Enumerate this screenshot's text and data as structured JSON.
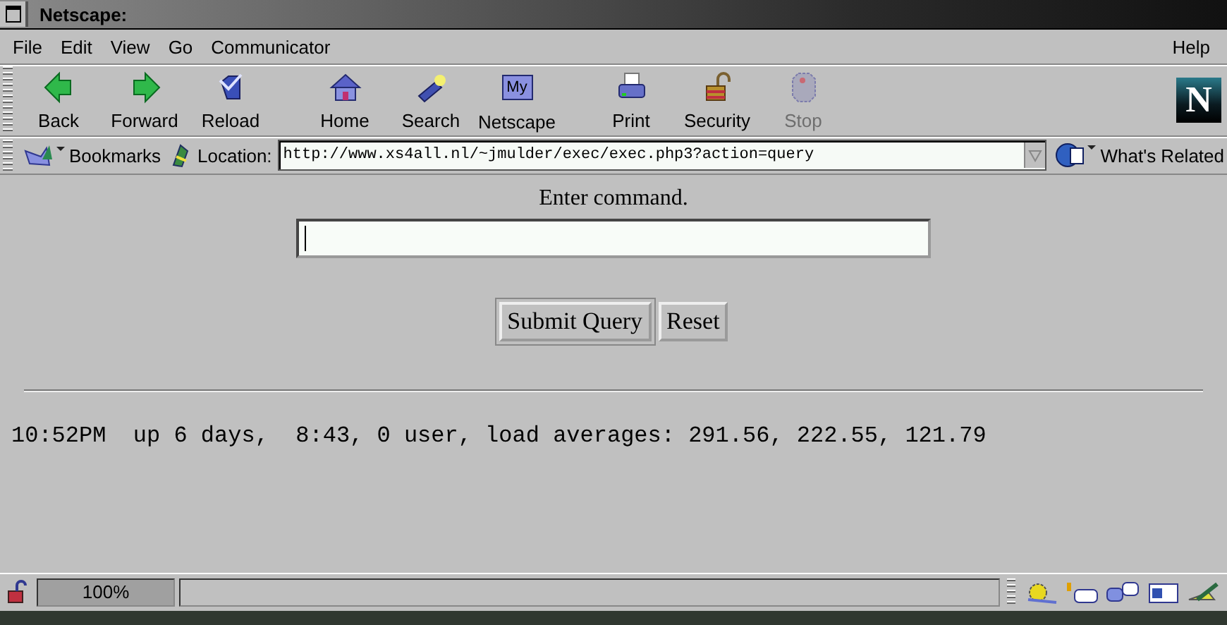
{
  "window": {
    "title": "Netscape:"
  },
  "menu": [
    {
      "label": "File"
    },
    {
      "label": "Edit"
    },
    {
      "label": "View"
    },
    {
      "label": "Go"
    },
    {
      "label": "Communicator"
    }
  ],
  "help_menu": {
    "label": "Help"
  },
  "toolbar": [
    {
      "label": "Back",
      "kind": "back",
      "disabled": false
    },
    {
      "label": "Forward",
      "kind": "forward",
      "disabled": false
    },
    {
      "label": "Reload",
      "kind": "reload",
      "disabled": false
    },
    {
      "label": "Home",
      "kind": "home",
      "disabled": false
    },
    {
      "label": "Search",
      "kind": "search",
      "disabled": false
    },
    {
      "label": "Netscape",
      "kind": "my",
      "disabled": false,
      "icon_text": "My"
    },
    {
      "label": "Print",
      "kind": "print",
      "disabled": false
    },
    {
      "label": "Security",
      "kind": "lock",
      "disabled": false
    },
    {
      "label": "Stop",
      "kind": "stop",
      "disabled": true
    }
  ],
  "logo": {
    "letter": "N"
  },
  "location_bar": {
    "bookmarks": "Bookmarks",
    "location_label": "Location:",
    "url": "http://www.xs4all.nl/~jmulder/exec/exec.php3?action=query",
    "related": "What's Related"
  },
  "page": {
    "prompt": "Enter command.",
    "buttons": [
      {
        "label": "Submit Query"
      },
      {
        "label": "Reset"
      }
    ],
    "output": "10:52PM  up 6 days,  8:43, 0 user, load averages: 291.56, 222.55, 121.79"
  },
  "status_bar": {
    "progress": "100%",
    "level": 1
  }
}
